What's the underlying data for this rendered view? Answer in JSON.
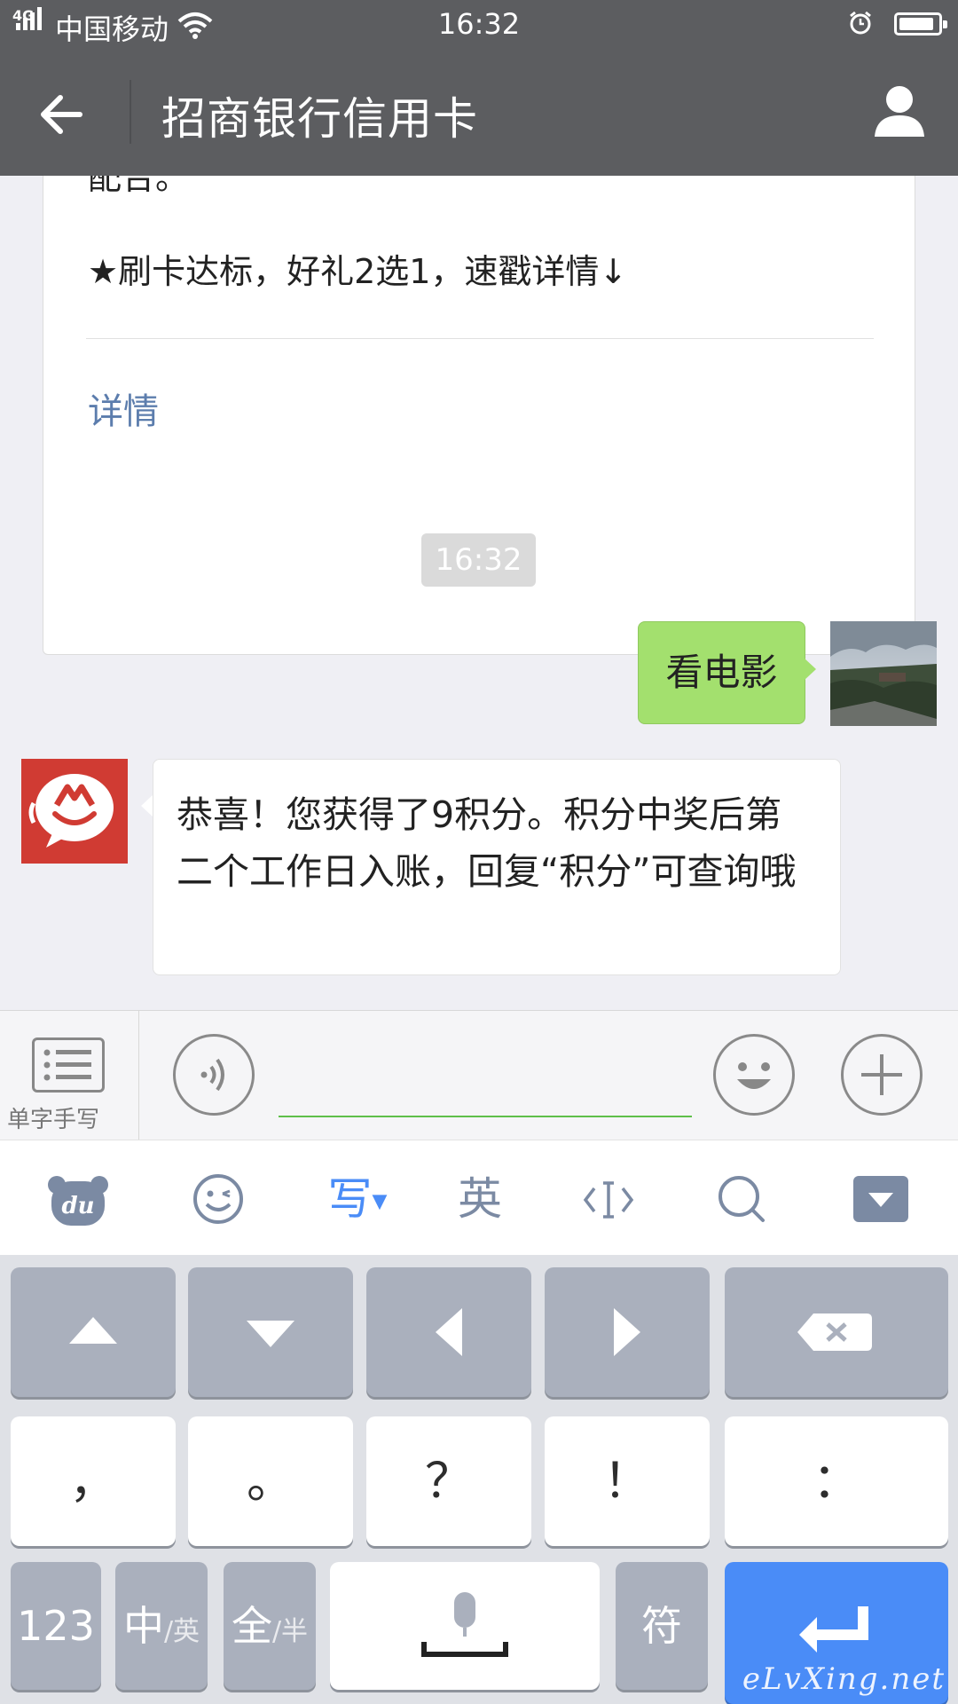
{
  "status_bar": {
    "network": "4G",
    "carrier": "中国移动",
    "time": "16:32"
  },
  "header": {
    "title": "招商银行信用卡",
    "back_icon": "arrow-left-icon",
    "profile_icon": "person-icon"
  },
  "chat": {
    "card": {
      "truncated_text": "配合。",
      "promo_text": "★刷卡达标，好礼2选1，速戳详情↓",
      "details_link": "详情"
    },
    "timestamp": "16:32",
    "messages": [
      {
        "sender": "me",
        "text": "看电影"
      },
      {
        "sender": "bank",
        "text": "恭喜！您获得了9积分。积分中奖后第二个工作日入账，回复“积分”可查询哦"
      }
    ]
  },
  "input_bar": {
    "handwriting_label": "单字手写",
    "voice_icon": "voice-icon",
    "emoji_icon": "smiley-icon",
    "plus_icon": "plus-icon"
  },
  "keyboard_toolbar": {
    "items": [
      "du-bear-icon",
      "emoji-icon",
      "写",
      "英",
      "cursor-icon",
      "search-icon",
      "hide-keyboard-icon"
    ]
  },
  "keyboard": {
    "row2": [
      "，",
      "。",
      "？",
      "！",
      "："
    ],
    "key_123": "123",
    "key_zh": "中",
    "key_zh_sub": "/英",
    "key_full": "全",
    "key_full_sub": "/半",
    "key_symbol": "符"
  },
  "watermark": "eLvXing.net",
  "colors": {
    "header_bg": "#5c5d60",
    "my_bubble": "#a3e06e",
    "link": "#5c7dad",
    "enter_key": "#4a8cf7"
  }
}
